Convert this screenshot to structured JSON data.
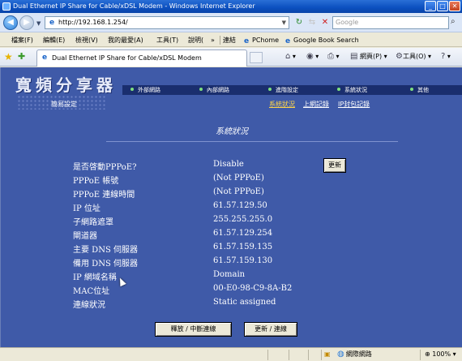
{
  "window": {
    "title": "Dual Ethernet IP Share for Cable/xDSL Modem - Windows Internet Explorer",
    "controls": {
      "minimize": "_",
      "maximize": "□",
      "close": "✕"
    }
  },
  "address": {
    "url": "http://192.168.1.254/",
    "search_placeholder": "Google"
  },
  "menu": {
    "items": [
      "檔案(F)",
      "編輯(E)",
      "檢視(V)",
      "我的最愛(A)",
      "工具(T)",
      "說明("
    ],
    "chevron": "»",
    "links_label": "連結",
    "links": [
      "PChome",
      "Google Book Search"
    ]
  },
  "tabbar": {
    "tab_title": "Dual Ethernet IP Share for Cable/xDSL Modem",
    "commands": [
      "網頁(P)",
      "工具(O)"
    ]
  },
  "router": {
    "logo": "寬頻分享器",
    "logo_sub": "簡易設定",
    "nav": [
      "外部網路",
      "內部網路",
      "進階設定",
      "系統狀況",
      "其他"
    ],
    "sub_links": [
      "系統狀況",
      "上網記錄",
      "IP封包記錄"
    ],
    "page_title": "系統狀況",
    "rows": [
      {
        "label": "是否啓動PPPoE?",
        "value": "Disable"
      },
      {
        "label": "PPPoE 帳號",
        "value": "(Not PPPoE)"
      },
      {
        "label": "PPPoE 連線時間",
        "value": "(Not PPPoE)"
      },
      {
        "label": "IP 位址",
        "value": "61.57.129.50"
      },
      {
        "label": "子網路遮罩",
        "value": "255.255.255.0"
      },
      {
        "label": "閘道器",
        "value": "61.57.129.254"
      },
      {
        "label": "主要 DNS 伺服器",
        "value": "61.57.159.135"
      },
      {
        "label": "備用 DNS 伺服器",
        "value": "61.57.159.130"
      },
      {
        "label": "IP 網域名稱",
        "value": "Domain"
      },
      {
        "label": "MAC位址",
        "value": "00-E0-98-C9-8A-B2"
      },
      {
        "label": "連線狀況",
        "value": "Static assigned"
      }
    ],
    "refresh_button": "更新",
    "release_button": "釋放 / 中斷連線",
    "renew_button": "更新 / 連線"
  },
  "status": {
    "zone": "網際網路",
    "zoom": "100%"
  },
  "colors": {
    "content_bg": "#3f5aa8",
    "nav_bg": "#1a2e6e",
    "active_link": "#ffd54a"
  }
}
